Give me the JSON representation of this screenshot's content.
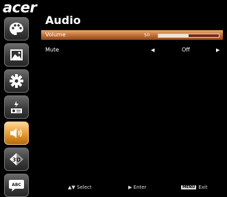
{
  "brand": "acer",
  "title": "Audio",
  "sidebar": {
    "items": [
      {
        "icon": "palette-icon",
        "active": false
      },
      {
        "icon": "image-icon",
        "active": false
      },
      {
        "icon": "gear-icon",
        "active": false
      },
      {
        "icon": "projector-management-icon",
        "active": false
      },
      {
        "icon": "audio-icon",
        "active": true
      },
      {
        "icon": "3d-icon",
        "active": false
      },
      {
        "icon": "language-abc-icon",
        "active": false
      }
    ],
    "language_badge": "ABC",
    "three_d_label": "3D"
  },
  "settings": {
    "volume": {
      "label": "Volume",
      "value": "50",
      "level": 0.5
    },
    "mute": {
      "label": "Mute",
      "value": "Off"
    }
  },
  "footer": {
    "select_label": "Select",
    "enter_label": "Enter",
    "menu_badge": "MENU",
    "exit_label": "Exit"
  },
  "colors": {
    "accent": "#c06e34",
    "active_nav": "#e89a2a"
  }
}
